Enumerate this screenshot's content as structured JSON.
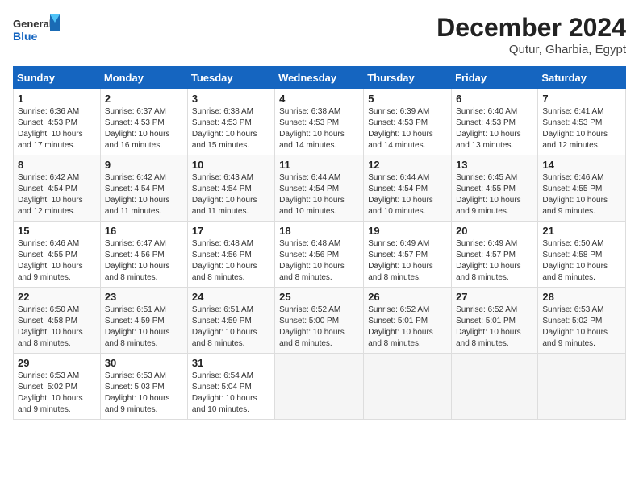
{
  "header": {
    "logo_general": "General",
    "logo_blue": "Blue",
    "month_title": "December 2024",
    "subtitle": "Qutur, Gharbia, Egypt"
  },
  "calendar": {
    "days_of_week": [
      "Sunday",
      "Monday",
      "Tuesday",
      "Wednesday",
      "Thursday",
      "Friday",
      "Saturday"
    ],
    "weeks": [
      [
        {
          "day": "1",
          "info": "Sunrise: 6:36 AM\nSunset: 4:53 PM\nDaylight: 10 hours and 17 minutes."
        },
        {
          "day": "2",
          "info": "Sunrise: 6:37 AM\nSunset: 4:53 PM\nDaylight: 10 hours and 16 minutes."
        },
        {
          "day": "3",
          "info": "Sunrise: 6:38 AM\nSunset: 4:53 PM\nDaylight: 10 hours and 15 minutes."
        },
        {
          "day": "4",
          "info": "Sunrise: 6:38 AM\nSunset: 4:53 PM\nDaylight: 10 hours and 14 minutes."
        },
        {
          "day": "5",
          "info": "Sunrise: 6:39 AM\nSunset: 4:53 PM\nDaylight: 10 hours and 14 minutes."
        },
        {
          "day": "6",
          "info": "Sunrise: 6:40 AM\nSunset: 4:53 PM\nDaylight: 10 hours and 13 minutes."
        },
        {
          "day": "7",
          "info": "Sunrise: 6:41 AM\nSunset: 4:53 PM\nDaylight: 10 hours and 12 minutes."
        }
      ],
      [
        {
          "day": "8",
          "info": "Sunrise: 6:42 AM\nSunset: 4:54 PM\nDaylight: 10 hours and 12 minutes."
        },
        {
          "day": "9",
          "info": "Sunrise: 6:42 AM\nSunset: 4:54 PM\nDaylight: 10 hours and 11 minutes."
        },
        {
          "day": "10",
          "info": "Sunrise: 6:43 AM\nSunset: 4:54 PM\nDaylight: 10 hours and 11 minutes."
        },
        {
          "day": "11",
          "info": "Sunrise: 6:44 AM\nSunset: 4:54 PM\nDaylight: 10 hours and 10 minutes."
        },
        {
          "day": "12",
          "info": "Sunrise: 6:44 AM\nSunset: 4:54 PM\nDaylight: 10 hours and 10 minutes."
        },
        {
          "day": "13",
          "info": "Sunrise: 6:45 AM\nSunset: 4:55 PM\nDaylight: 10 hours and 9 minutes."
        },
        {
          "day": "14",
          "info": "Sunrise: 6:46 AM\nSunset: 4:55 PM\nDaylight: 10 hours and 9 minutes."
        }
      ],
      [
        {
          "day": "15",
          "info": "Sunrise: 6:46 AM\nSunset: 4:55 PM\nDaylight: 10 hours and 9 minutes."
        },
        {
          "day": "16",
          "info": "Sunrise: 6:47 AM\nSunset: 4:56 PM\nDaylight: 10 hours and 8 minutes."
        },
        {
          "day": "17",
          "info": "Sunrise: 6:48 AM\nSunset: 4:56 PM\nDaylight: 10 hours and 8 minutes."
        },
        {
          "day": "18",
          "info": "Sunrise: 6:48 AM\nSunset: 4:56 PM\nDaylight: 10 hours and 8 minutes."
        },
        {
          "day": "19",
          "info": "Sunrise: 6:49 AM\nSunset: 4:57 PM\nDaylight: 10 hours and 8 minutes."
        },
        {
          "day": "20",
          "info": "Sunrise: 6:49 AM\nSunset: 4:57 PM\nDaylight: 10 hours and 8 minutes."
        },
        {
          "day": "21",
          "info": "Sunrise: 6:50 AM\nSunset: 4:58 PM\nDaylight: 10 hours and 8 minutes."
        }
      ],
      [
        {
          "day": "22",
          "info": "Sunrise: 6:50 AM\nSunset: 4:58 PM\nDaylight: 10 hours and 8 minutes."
        },
        {
          "day": "23",
          "info": "Sunrise: 6:51 AM\nSunset: 4:59 PM\nDaylight: 10 hours and 8 minutes."
        },
        {
          "day": "24",
          "info": "Sunrise: 6:51 AM\nSunset: 4:59 PM\nDaylight: 10 hours and 8 minutes."
        },
        {
          "day": "25",
          "info": "Sunrise: 6:52 AM\nSunset: 5:00 PM\nDaylight: 10 hours and 8 minutes."
        },
        {
          "day": "26",
          "info": "Sunrise: 6:52 AM\nSunset: 5:01 PM\nDaylight: 10 hours and 8 minutes."
        },
        {
          "day": "27",
          "info": "Sunrise: 6:52 AM\nSunset: 5:01 PM\nDaylight: 10 hours and 8 minutes."
        },
        {
          "day": "28",
          "info": "Sunrise: 6:53 AM\nSunset: 5:02 PM\nDaylight: 10 hours and 9 minutes."
        }
      ],
      [
        {
          "day": "29",
          "info": "Sunrise: 6:53 AM\nSunset: 5:02 PM\nDaylight: 10 hours and 9 minutes."
        },
        {
          "day": "30",
          "info": "Sunrise: 6:53 AM\nSunset: 5:03 PM\nDaylight: 10 hours and 9 minutes."
        },
        {
          "day": "31",
          "info": "Sunrise: 6:54 AM\nSunset: 5:04 PM\nDaylight: 10 hours and 10 minutes."
        },
        {
          "day": "",
          "info": ""
        },
        {
          "day": "",
          "info": ""
        },
        {
          "day": "",
          "info": ""
        },
        {
          "day": "",
          "info": ""
        }
      ]
    ]
  }
}
